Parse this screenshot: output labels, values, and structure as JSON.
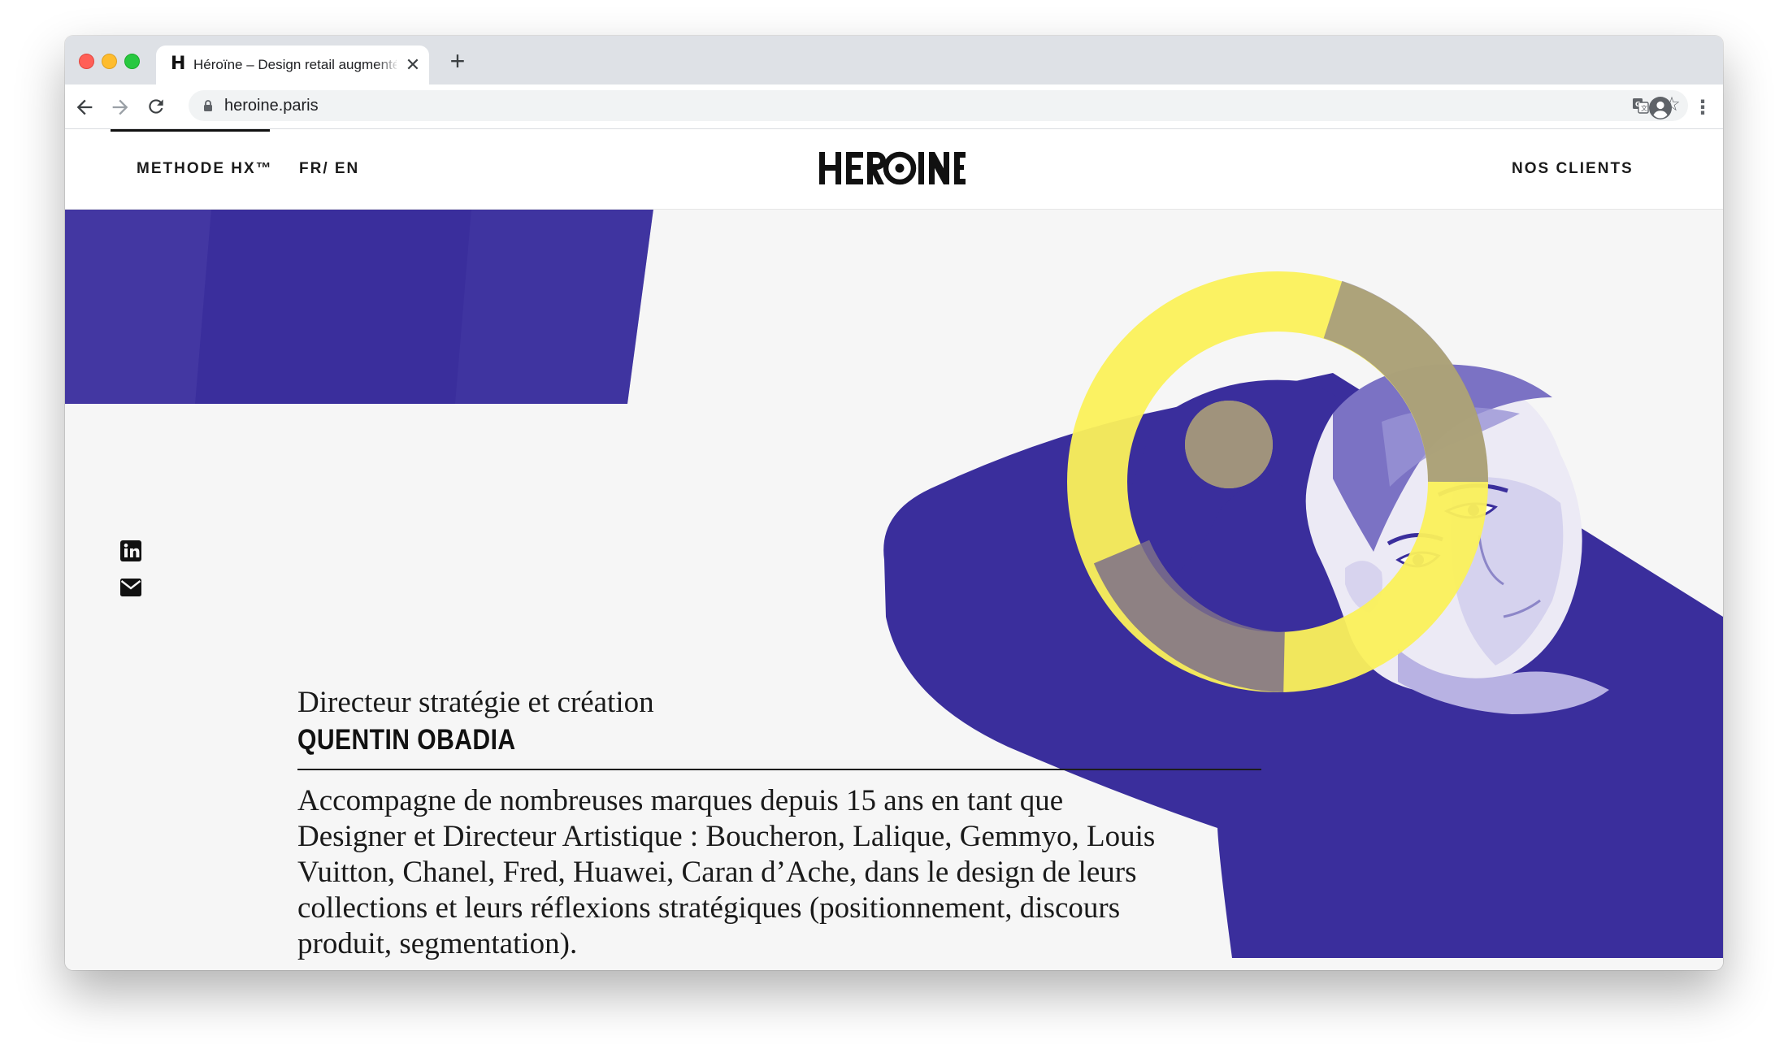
{
  "browser": {
    "tab_title": "Héroïne – Design retail augmenté",
    "tab_favicon": "H",
    "url": "heroine.paris",
    "icons": {
      "back": "back-arrow-icon",
      "forward": "forward-arrow-icon",
      "reload": "reload-icon",
      "lock": "lock-icon",
      "translate": "translate-icon",
      "bookmark": "star-icon",
      "profile": "profile-icon",
      "menu": "kebab-menu-icon",
      "close_tab": "close-icon",
      "new_tab": "plus-icon"
    }
  },
  "site": {
    "logo": "HEROINE",
    "nav": {
      "method": "METHODE HX™",
      "lang": "FR/ EN",
      "clients": "NOS CLIENTS"
    },
    "social": [
      "linkedin-icon",
      "mail-icon"
    ],
    "colors": {
      "accent_blue": "#3a2e9c",
      "accent_yellow": "#fbf15a",
      "background": "#f6f6f6"
    }
  },
  "profile": {
    "role": "Directeur stratégie et création",
    "name": "QUENTIN OBADIA",
    "bio": "Accompagne de nombreuses marques depuis 15 ans en tant que Designer et Directeur Artistique : Boucheron, Lalique, Gemmyo, Louis Vuitton, Chanel, Fred, Huawei, Caran d’Ache, dans le design de leurs collections et leurs réflexions stratégiques (positionnement, discours produit, segmentation)."
  }
}
